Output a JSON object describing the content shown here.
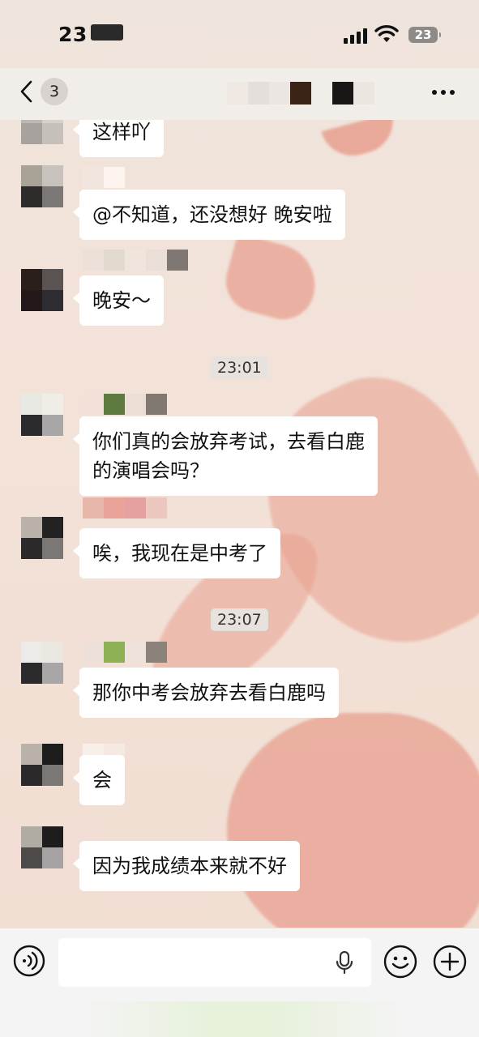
{
  "status_bar": {
    "time": "23",
    "battery": "23"
  },
  "nav": {
    "back_count": "3"
  },
  "chat": {
    "messages": [
      {
        "text": "这样吖"
      },
      {
        "text": "@不知道，还没想好 晚安啦"
      },
      {
        "text": "晚安～"
      },
      {
        "text": "你们真的会放弃考试，去看白鹿\n的演唱会吗？"
      },
      {
        "text": "唉，我现在是中考了"
      },
      {
        "text": "那你中考会放弃去看白鹿吗"
      },
      {
        "text": "会"
      },
      {
        "text": "因为我成绩本来就不好"
      }
    ],
    "timestamps": [
      "23:01",
      "23:07"
    ]
  },
  "input": {
    "value": "",
    "placeholder": ""
  },
  "icons": {
    "back": "chevron-left-icon",
    "more": "more-horizontal-icon",
    "voice": "voice-icon",
    "mic": "microphone-icon",
    "emoji": "emoji-icon",
    "plus": "plus-icon"
  },
  "colors": {
    "bubble": "#ffffff",
    "timestamp_bg": "#e8e2de",
    "accent_wallpaper": "#e8a08f"
  }
}
